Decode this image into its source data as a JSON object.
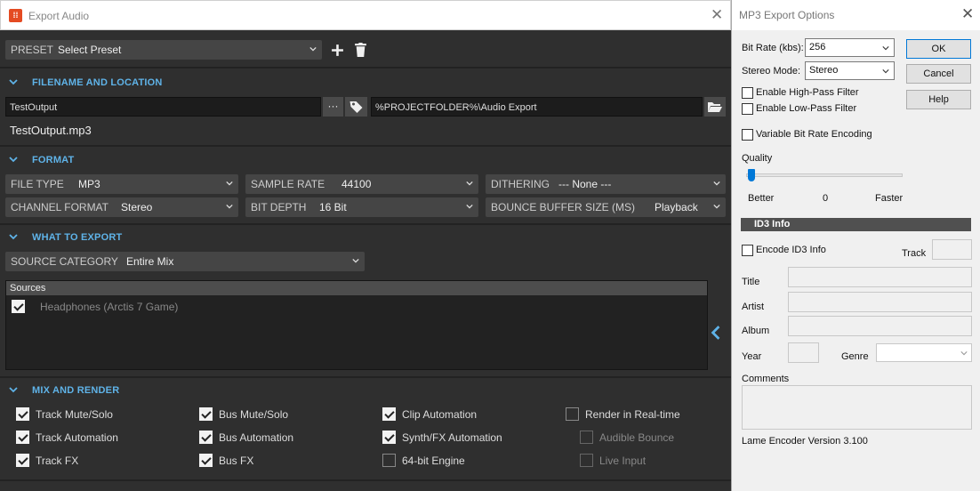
{
  "export_dialog": {
    "title": "Export Audio",
    "preset": {
      "label": "PRESET",
      "value": "Select Preset"
    },
    "filename_section": {
      "heading": "FILENAME AND LOCATION",
      "filename_value": "TestOutput",
      "browse_dots": "···",
      "folder_value": "%PROJECTFOLDER%\\Audio Export",
      "full_filename": "TestOutput.mp3"
    },
    "format_section": {
      "heading": "FORMAT",
      "file_type": {
        "label": "FILE TYPE",
        "value": "MP3"
      },
      "sample_rate": {
        "label": "SAMPLE RATE",
        "value": "44100"
      },
      "dithering": {
        "label": "DITHERING",
        "value": "--- None ---"
      },
      "channel_format": {
        "label": "CHANNEL FORMAT",
        "value": "Stereo"
      },
      "bit_depth": {
        "label": "BIT DEPTH",
        "value": "16 Bit"
      },
      "bounce_buffer": {
        "label": "BOUNCE BUFFER SIZE (MS)",
        "value": "Playback"
      }
    },
    "what_section": {
      "heading": "WHAT TO EXPORT",
      "source_category": {
        "label": "SOURCE CATEGORY",
        "value": "Entire Mix"
      },
      "sources_header": "Sources",
      "sources": [
        {
          "label": "Headphones (Arctis 7 Game)",
          "checked": true
        }
      ]
    },
    "mix_section": {
      "heading": "MIX AND RENDER",
      "options": [
        {
          "label": "Track Mute/Solo",
          "checked": true,
          "enabled": true
        },
        {
          "label": "Bus Mute/Solo",
          "checked": true,
          "enabled": true
        },
        {
          "label": "Clip Automation",
          "checked": true,
          "enabled": true
        },
        {
          "label": "Render in Real-time",
          "checked": false,
          "enabled": true
        },
        {
          "label": "Track Automation",
          "checked": true,
          "enabled": true
        },
        {
          "label": "Bus Automation",
          "checked": true,
          "enabled": true
        },
        {
          "label": "Synth/FX Automation",
          "checked": true,
          "enabled": true
        },
        {
          "label": "Audible Bounce",
          "checked": false,
          "enabled": false
        },
        {
          "label": "Track FX",
          "checked": true,
          "enabled": true
        },
        {
          "label": "Bus FX",
          "checked": true,
          "enabled": true
        },
        {
          "label": "64-bit Engine",
          "checked": false,
          "enabled": true
        },
        {
          "label": "Live Input",
          "checked": false,
          "enabled": false
        }
      ]
    },
    "colors": {
      "accent": "#5fb3e8",
      "panel": "#2f2f2f",
      "logo": "#e44b22"
    }
  },
  "mp3_dialog": {
    "title": "MP3 Export Options",
    "bit_rate": {
      "label": "Bit Rate (kbs):",
      "value": "256"
    },
    "stereo_mode": {
      "label": "Stereo Mode:",
      "value": "Stereo"
    },
    "buttons": {
      "ok": "OK",
      "cancel": "Cancel",
      "help": "Help"
    },
    "high_pass": "Enable High-Pass Filter",
    "low_pass": "Enable Low-Pass Filter",
    "vbr": "Variable Bit Rate Encoding",
    "quality": {
      "label": "Quality",
      "better": "Better",
      "value": "0",
      "faster": "Faster",
      "level": 0
    },
    "id3_header": "ID3 Info",
    "encode_id3": "Encode ID3 Info",
    "track_label": "Track",
    "title_label": "Title",
    "artist_label": "Artist",
    "album_label": "Album",
    "year_label": "Year",
    "genre_label": "Genre",
    "comments_label": "Comments",
    "encoder_version": "Lame Encoder Version 3.100"
  }
}
